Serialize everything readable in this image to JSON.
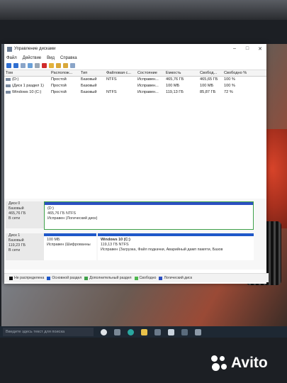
{
  "window": {
    "title": "Управление дисками",
    "controls": [
      "–",
      "□",
      "✕"
    ]
  },
  "menu": [
    "Файл",
    "Действие",
    "Вид",
    "Справка"
  ],
  "table": {
    "headers": [
      "Том",
      "Располож...",
      "Тип",
      "Файловая с...",
      "Состояние",
      "Емкость",
      "Свобод...",
      "Свободно %"
    ],
    "rows": [
      [
        "(D:)",
        "Простой",
        "Базовый",
        "NTFS",
        "Исправен...",
        "465,76 ГБ",
        "465,65 ГБ",
        "100 %"
      ],
      [
        "(Диск 1 раздел 1)",
        "Простой",
        "Базовый",
        "",
        "Исправен...",
        "100 МБ",
        "100 МБ",
        "100 %"
      ],
      [
        "Windows 10 (C:)",
        "Простой",
        "Базовый",
        "NTFS",
        "Исправен...",
        "119,13 ГБ",
        "85,87 ГБ",
        "72 %"
      ]
    ]
  },
  "disks": [
    {
      "label": [
        "Диск 0",
        "Базовый",
        "465,76 ГБ",
        "В сети"
      ],
      "partitions": [
        {
          "lines": [
            "(D:)",
            "465,76 ГБ NTFS",
            "Исправен (Логический диск)"
          ]
        }
      ]
    },
    {
      "label": [
        "Диск 1",
        "Базовый",
        "119,23 ГБ",
        "В сети"
      ],
      "partitions": [
        {
          "lines": [
            "",
            "100 МБ",
            "Исправен (Шифрованны"
          ]
        },
        {
          "lines": [
            "Windows 10  (C:)",
            "119,13 ГБ NTFS",
            "Исправен (Загрузка, Файл подкачки, Аварийный дамп памяти, Базов"
          ]
        }
      ]
    }
  ],
  "legend": [
    {
      "label": "Не распределена",
      "color": "#111111"
    },
    {
      "label": "Основной раздел",
      "color": "#1f58c9"
    },
    {
      "label": "Дополнительный раздел",
      "color": "#3fa14a"
    },
    {
      "label": "Свободно",
      "color": "#4fb84f"
    },
    {
      "label": "Логический диск",
      "color": "#2c4fc2"
    }
  ],
  "taskbar": {
    "search_placeholder": "Введите здесь текст для поиска"
  },
  "watermark": "Avito"
}
